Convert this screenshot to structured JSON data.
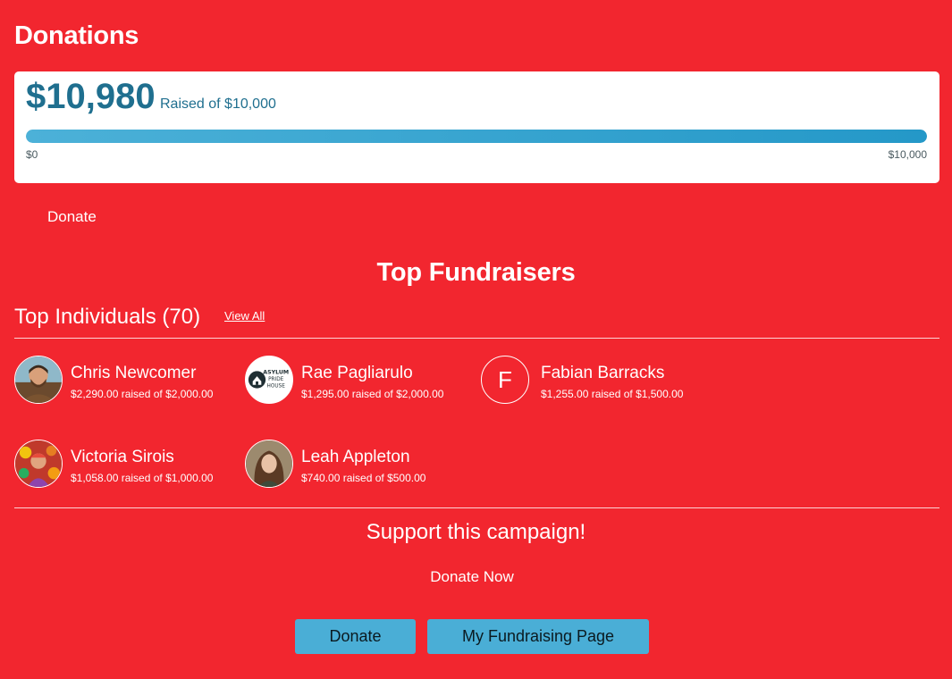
{
  "page": {
    "title": "Donations"
  },
  "progress": {
    "raised": "$10,980",
    "raised_of": "Raised of $10,000",
    "min_label": "$0",
    "max_label": "$10,000",
    "fill_fraction": 1.0,
    "color_start": "#4cb1d8",
    "color_end": "#2498c8"
  },
  "donate_link": "Donate",
  "top_fundraisers": {
    "title": "Top Fundraisers",
    "individuals_title": "Top Individuals (70)",
    "view_all": "View All",
    "items": [
      {
        "name": "Chris Newcomer",
        "raised": "$2,290.00 raised of $2,000.00",
        "avatar": "photo"
      },
      {
        "name": "Rae Pagliarulo",
        "raised": "$1,295.00 raised of $2,000.00",
        "avatar": "logo",
        "logo_text": [
          "ASYLUM",
          "PRIDE",
          "HOUSE"
        ]
      },
      {
        "name": "Fabian Barracks",
        "raised": "$1,255.00 raised of $1,500.00",
        "avatar": "letter",
        "letter": "F"
      },
      {
        "name": "Victoria Sirois",
        "raised": "$1,058.00 raised of $1,000.00",
        "avatar": "photo"
      },
      {
        "name": "Leah Appleton",
        "raised": "$740.00 raised of $500.00",
        "avatar": "photo"
      }
    ]
  },
  "support": {
    "title": "Support this campaign!",
    "donate_now": "Donate Now",
    "donate_button": "Donate",
    "fundraising_button": "My Fundraising Page"
  },
  "colors": {
    "background": "#f2262f",
    "accent_text": "#1f6f8f",
    "button": "#4aaed6"
  }
}
